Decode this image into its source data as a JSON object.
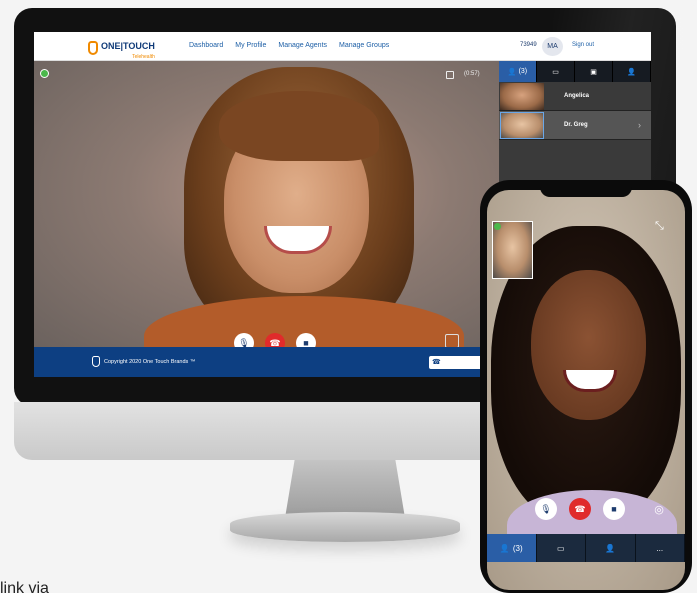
{
  "app": {
    "logo_text": "ONE|TOUCH",
    "logo_sub": "Telehealth",
    "nav": [
      "Dashboard",
      "My Profile",
      "Manage Agents",
      "Manage Groups"
    ],
    "user_id": "73949",
    "avatar_initials": "MA",
    "signout": "Sign out",
    "timer": "(0:57)",
    "footer_copyright": "Copyright 2020 One Touch Brands ™",
    "footer_phone": "☎"
  },
  "sidebar": {
    "tabs": [
      {
        "icon": "contacts-icon",
        "label": "(3)"
      },
      {
        "icon": "chat-icon",
        "label": ""
      },
      {
        "icon": "screen-share-icon",
        "label": ""
      },
      {
        "icon": "add-user-icon",
        "label": ""
      }
    ],
    "participants": [
      {
        "name": "Angelica"
      },
      {
        "name": "Dr. Greg"
      }
    ]
  },
  "phone": {
    "nav": [
      {
        "icon": "contacts-icon",
        "label": "(3)"
      },
      {
        "icon": "chat-icon",
        "label": ""
      },
      {
        "icon": "add-user-icon",
        "label": ""
      },
      {
        "icon": "more-icon",
        "label": "..."
      }
    ]
  },
  "caption": "link via",
  "colors": {
    "brand_blue": "#0d3f82",
    "accent_orange": "#f08a00",
    "end_call_red": "#e02b2b",
    "online_green": "#4bb84b"
  }
}
